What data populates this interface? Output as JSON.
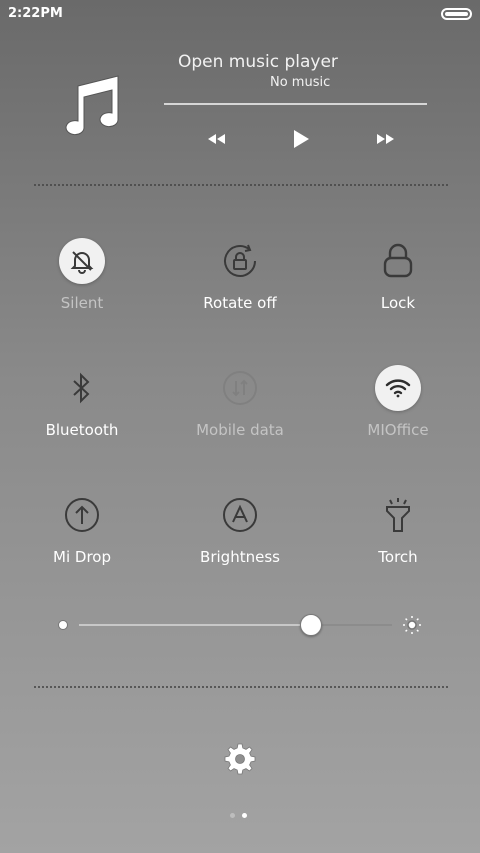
{
  "status_bar": {
    "time": "2:22PM"
  },
  "music": {
    "title": "Open music player",
    "subtitle": "No music",
    "controls": [
      "previous-icon",
      "play-icon",
      "next-icon"
    ]
  },
  "toggles": [
    {
      "label": "Silent",
      "icon": "bell-off-icon",
      "state": "active"
    },
    {
      "label": "Rotate off",
      "icon": "rotate-lock-icon",
      "state": "on"
    },
    {
      "label": "Lock",
      "icon": "lock-icon",
      "state": "on"
    },
    {
      "label": "Bluetooth",
      "icon": "bluetooth-icon",
      "state": "on"
    },
    {
      "label": "Mobile data",
      "icon": "mobile-data-icon",
      "state": "disabled"
    },
    {
      "label": "MIOffice",
      "icon": "wifi-icon",
      "state": "active"
    },
    {
      "label": "Mi Drop",
      "icon": "mi-drop-icon",
      "state": "on"
    },
    {
      "label": "Brightness",
      "icon": "auto-brightness-icon",
      "state": "on"
    },
    {
      "label": "Torch",
      "icon": "torch-icon",
      "state": "on"
    }
  ],
  "brightness": {
    "level": 0.74
  },
  "pager": {
    "pages": 2,
    "current": 1
  },
  "colors": {
    "active_bg": "#f1f1f1",
    "icon_dark": "#3a3a3a",
    "dim_text": "#c4c4c4"
  }
}
